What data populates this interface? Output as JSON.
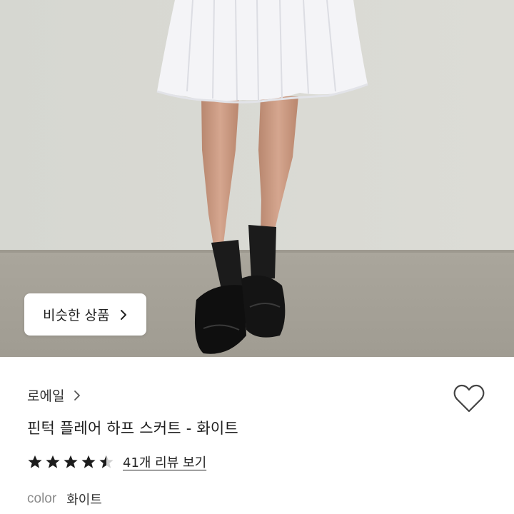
{
  "photo": {
    "subject": "product-photo",
    "colors": {
      "wall": "#d8d9d3",
      "floor": "#a8a49a",
      "skirt": "#f4f4f6",
      "skin": "#c99a82",
      "sock": "#1b1b1b",
      "shoe": "#111111"
    }
  },
  "similar_button": {
    "label": "비슷한 상품"
  },
  "product": {
    "brand": "로에일",
    "title": "핀턱 플레어 하프 스커트 - 화이트",
    "rating": 4.5,
    "review_text": "41개 리뷰 보기",
    "color_label": "color",
    "color_value": "화이트"
  },
  "icons": {
    "wishlist": "heart-outline-icon",
    "chevron": "chevron-right-icon",
    "star": "star-icon"
  }
}
